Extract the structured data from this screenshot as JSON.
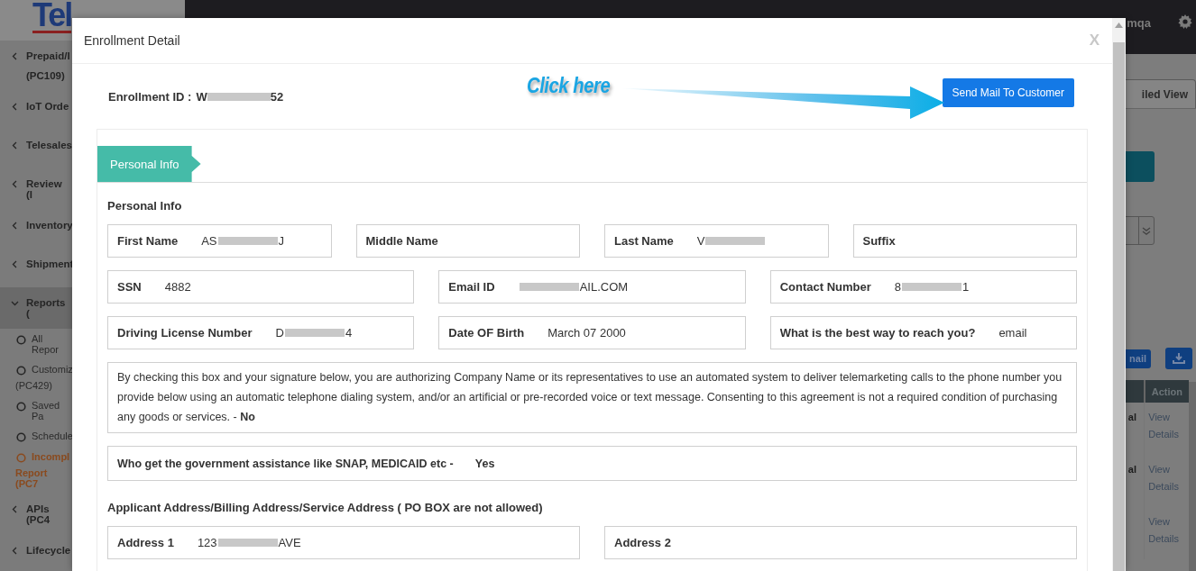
{
  "backdrop": {
    "logo": "Tel",
    "sidebar": [
      {
        "kind": "section",
        "lines": [
          "Prepaid/I",
          "(PC109)"
        ],
        "expanded": false
      },
      {
        "kind": "section",
        "lines": [
          "IoT Orde"
        ],
        "expanded": false
      },
      {
        "kind": "section",
        "lines": [
          "Telesales"
        ],
        "expanded": false
      },
      {
        "kind": "section",
        "lines": [
          "Review (I"
        ],
        "expanded": false
      },
      {
        "kind": "section",
        "lines": [
          "Inventory"
        ],
        "expanded": false
      },
      {
        "kind": "section",
        "lines": [
          "Shipment"
        ],
        "expanded": false
      },
      {
        "kind": "section",
        "lines": [
          "Reports ("
        ],
        "expanded": true
      },
      {
        "kind": "subitem",
        "lines": [
          "All Repor"
        ],
        "selected": false
      },
      {
        "kind": "subitem",
        "lines": [
          "Customiz",
          "(PC429)"
        ],
        "selected": false
      },
      {
        "kind": "subitem",
        "lines": [
          "Saved Pa"
        ],
        "selected": false
      },
      {
        "kind": "subitem",
        "lines": [
          "Schedule"
        ],
        "selected": false
      },
      {
        "kind": "subitem",
        "lines": [
          "Incompl",
          "Report (PC7"
        ],
        "selected": true
      },
      {
        "kind": "section",
        "lines": [
          "APIs (PC4"
        ],
        "expanded": false
      },
      {
        "kind": "section",
        "lines": [
          "Lifecycle"
        ],
        "expanded": false
      }
    ],
    "user": "mqa",
    "view_tab": "iled View",
    "mail_button": "nail",
    "table": {
      "column": "Action",
      "rows": [
        {
          "cell": "al",
          "action": "View Details"
        },
        {
          "cell": "al",
          "action": "View Details"
        },
        {
          "action": "View Details"
        }
      ]
    }
  },
  "modal": {
    "title": "Enrollment Detail",
    "close": "X",
    "enrollment_id": {
      "label": "Enrollment ID :",
      "value_parts": [
        {
          "kind": "text",
          "text": "W"
        },
        {
          "kind": "redacted"
        },
        {
          "kind": "text",
          "text": "52"
        }
      ]
    },
    "annotation": "Click here",
    "send_button": "Send Mail To Customer",
    "tabs": [
      {
        "label": "Personal Info",
        "selected": true
      }
    ],
    "section_title": "Personal Info",
    "field_rows": [
      [
        {
          "label": "First Name",
          "value_parts": [
            {
              "kind": "text",
              "text": "AS"
            },
            {
              "kind": "redacted"
            },
            {
              "kind": "text",
              "text": "J"
            }
          ]
        },
        {
          "label": "Middle Name"
        },
        {
          "label": "Last Name",
          "value_parts": [
            {
              "kind": "text",
              "text": "V"
            },
            {
              "kind": "redacted"
            }
          ]
        },
        {
          "label": "Suffix"
        }
      ],
      [
        {
          "label": "SSN",
          "value": "4882"
        },
        {
          "label": "Email ID",
          "value_parts": [
            {
              "kind": "redacted"
            },
            {
              "kind": "text",
              "text": "AIL.COM"
            }
          ]
        },
        {
          "label": "Contact Number",
          "value_parts": [
            {
              "kind": "text",
              "text": "8"
            },
            {
              "kind": "redacted"
            },
            {
              "kind": "text",
              "text": "1"
            }
          ]
        }
      ],
      [
        {
          "label": "Driving License Number",
          "value_parts": [
            {
              "kind": "text",
              "text": "D"
            },
            {
              "kind": "redacted"
            },
            {
              "kind": "text",
              "text": "4"
            }
          ]
        },
        {
          "label": "Date OF Birth",
          "value": "March 07 2000"
        },
        {
          "label": "What is the best way to reach you?",
          "value": "email"
        }
      ]
    ],
    "consent": "By checking this box and your signature below, you are authorizing Company Name or its representatives to use an automated system to deliver telemarketing calls to the phone number you provide below using an automatic telephone dialing system, and/or an artificial or pre-recorded voice or text message. Consenting to this agreement is not a required condition of purchasing any goods or services. - **No**",
    "assistance": {
      "label": "Who get the government assistance like SNAP, MEDICAID etc -",
      "value": "Yes"
    },
    "address_title": "Applicant Address/Billing Address/Service Address ( PO BOX are not allowed)",
    "address_rows": [
      [
        {
          "label": "Address 1",
          "value_parts": [
            {
              "kind": "text",
              "text": "123"
            },
            {
              "kind": "redacted"
            },
            {
              "kind": "text",
              "text": "AVE"
            }
          ]
        },
        {
          "label": "Address 2"
        }
      ]
    ]
  }
}
